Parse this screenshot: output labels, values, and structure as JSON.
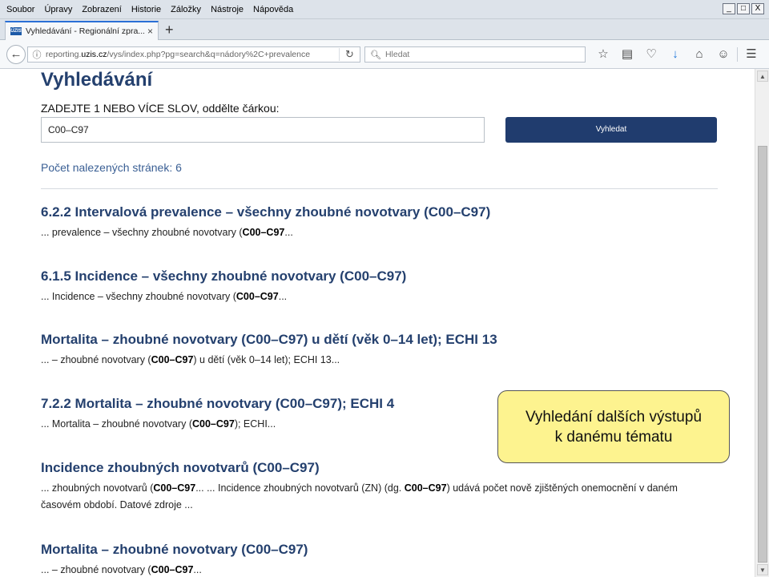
{
  "menu": [
    "Soubor",
    "Úpravy",
    "Zobrazení",
    "Historie",
    "Záložky",
    "Nástroje",
    "Nápověda"
  ],
  "window_buttons": [
    "_",
    "□",
    "X"
  ],
  "tab": {
    "favicon_text": "ÚZIS",
    "title": "Vyhledávání - Regionální zpra...",
    "close": "×",
    "new_tab": "+"
  },
  "nav": {
    "url_prefix": "reporting.",
    "url_domain": "uzis.cz",
    "url_rest": "/vys/index.php?pg=search&q=nádory%2C+prevalence",
    "search_placeholder": "Hledat"
  },
  "page": {
    "title": "Vyhledávání",
    "prompt_label": "ZADEJTE 1 NEBO VÍCE SLOV, oddělte čárkou:",
    "search_value": "C00–C97",
    "search_button": "Vyhledat",
    "count_text": "Počet nalezených stránek: 6"
  },
  "results": [
    {
      "title": "6.2.2 Intervalová prevalence – všechny zhoubné novotvary (C00–C97)",
      "snippet_pre": "... prevalence – všechny zhoubné novotvary (",
      "snippet_bold": "C00–C97",
      "snippet_post": "..."
    },
    {
      "title": "6.1.5 Incidence – všechny zhoubné novotvary (C00–C97)",
      "snippet_pre": "... Incidence – všechny zhoubné novotvary (",
      "snippet_bold": "C00–C97",
      "snippet_post": "..."
    },
    {
      "title": "Mortalita – zhoubné novotvary (C00–C97) u dětí (věk 0–14 let); ECHI 13",
      "snippet_pre": "... – zhoubné novotvary (",
      "snippet_bold": "C00–C97",
      "snippet_post": ") u dětí (věk 0–14 let); ECHI 13..."
    },
    {
      "title": "7.2.2 Mortalita – zhoubné novotvary (C00–C97); ECHI 4",
      "snippet_pre": "... Mortalita – zhoubné novotvary (",
      "snippet_bold": "C00–C97",
      "snippet_post": "); ECHI..."
    },
    {
      "title": "Incidence zhoubných novotvarů (C00–C97)",
      "snippet_pre": "... zhoubných novotvarů (",
      "snippet_bold": "C00–C97",
      "snippet_mid": "... ... Incidence zhoubných novotvarů (ZN) (dg. ",
      "snippet_bold2": "C00–C97",
      "snippet_post": ") udává počet nově zjištěných onemocnění v daném časovém období. Datové zdroje ..."
    },
    {
      "title": "Mortalita – zhoubné novotvary (C00–C97)",
      "snippet_pre": "... – zhoubné novotvary (",
      "snippet_bold": "C00–C97",
      "snippet_post": "..."
    }
  ],
  "callout": {
    "line1": "Vyhledání dalších výstupů",
    "line2": "k danému tématu"
  },
  "colors": {
    "heading": "#24406e",
    "button": "#203c6e",
    "callout_bg": "#fdf38f",
    "count": "#3a5f94"
  },
  "icons": [
    "back-icon",
    "info-icon",
    "reload-icon",
    "search-icon",
    "star-icon",
    "reading-list-icon",
    "pocket-icon",
    "download-icon",
    "home-icon",
    "emoji-icon",
    "hamburger-menu-icon"
  ]
}
